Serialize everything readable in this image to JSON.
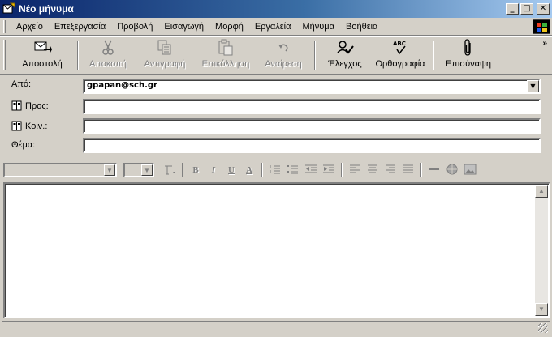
{
  "window": {
    "title": "Νέο μήνυμα",
    "controls": {
      "minimize": "_",
      "maximize": "□",
      "close": "✕"
    }
  },
  "menubar": {
    "items": [
      "Αρχείο",
      "Επεξεργασία",
      "Προβολή",
      "Εισαγωγή",
      "Μορφή",
      "Εργαλεία",
      "Μήνυμα",
      "Βοήθεια"
    ]
  },
  "toolbar": {
    "send": "Αποστολή",
    "cut": "Αποκοπή",
    "copy": "Αντιγραφή",
    "paste": "Επικόλληση",
    "undo": "Αναίρεση",
    "check": "Έλεγχος",
    "spelling": "Ορθογραφία",
    "attach": "Επισύναψη",
    "more": "»"
  },
  "header": {
    "from_label": "Από:",
    "from_value": "gpapan@sch.gr",
    "to_label": "Προς:",
    "to_value": "",
    "cc_label": "Κοιν.:",
    "cc_value": "",
    "subject_label": "Θέμα:",
    "subject_value": ""
  },
  "formatbar": {
    "bold": "B",
    "italic": "I",
    "underline": "U",
    "font_color": "A"
  },
  "icons": {
    "send": "send-mail-icon",
    "cut": "scissors-icon",
    "copy": "copy-icon",
    "paste": "paste-icon",
    "undo": "undo-icon",
    "check": "check-names-icon",
    "spelling": "spelling-icon",
    "attach": "paperclip-icon"
  },
  "colors": {
    "title_start": "#0a246a",
    "title_end": "#a6caf0",
    "face": "#d4d0c8"
  }
}
